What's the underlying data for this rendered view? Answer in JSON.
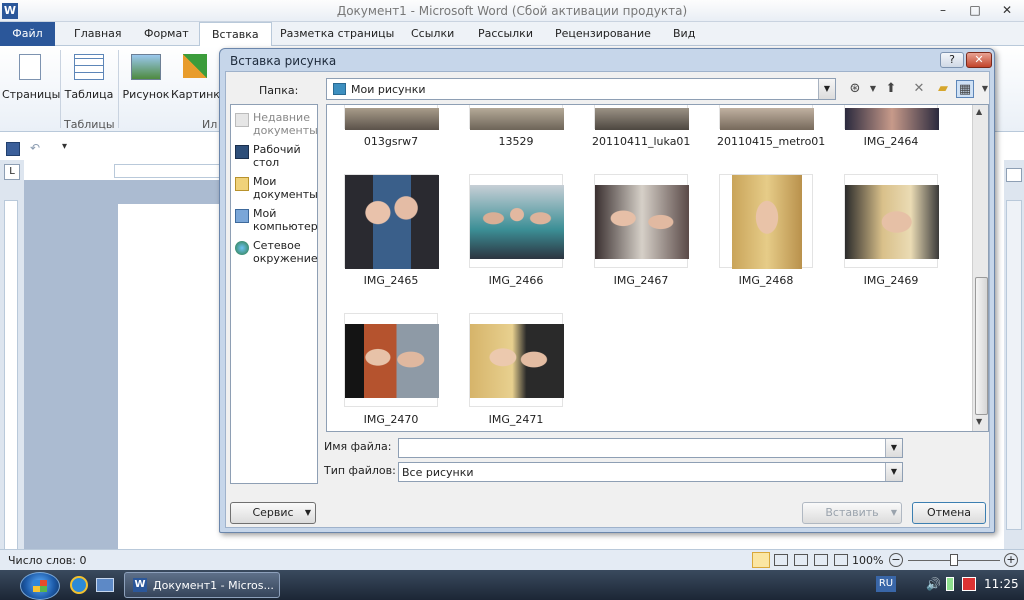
{
  "window": {
    "app_icon": "W",
    "title": "Документ1  -  Microsoft Word (Сбой активации продукта)",
    "controls": {
      "minimize": "–",
      "maximize": "□",
      "close": "✕"
    }
  },
  "ribbon": {
    "tabs": [
      "Файл",
      "Главная",
      "Формат",
      "Вставка",
      "Разметка страницы",
      "Ссылки",
      "Рассылки",
      "Рецензирование",
      "Вид"
    ],
    "buttons": {
      "pages": "Страницы",
      "table": "Таблица",
      "picture": "Рисунок",
      "clipart": "Картинки"
    },
    "groups": {
      "tables": "Таблицы",
      "illustrations_partial": "Ил"
    }
  },
  "dialog": {
    "title": "Вставка рисунка",
    "help": "?",
    "close": "✕",
    "folder_label": "Папка:",
    "folder_value": "Мои рисунки",
    "places": [
      "Недавние документы",
      "Рабочий стол",
      "Мои документы",
      "Мой компьютер",
      "Сетевое окружение"
    ],
    "files_row1": [
      "013gsrw7",
      "13529",
      "20110411_luka01",
      "20110415_metro01",
      "IMG_2464"
    ],
    "files_row2": [
      "IMG_2465",
      "IMG_2466",
      "IMG_2467",
      "IMG_2468",
      "IMG_2469"
    ],
    "files_row3": [
      "IMG_2470",
      "IMG_2471"
    ],
    "filename_label": "Имя файла:",
    "filename_value": "",
    "filetype_label": "Тип файлов:",
    "filetype_value": "Все рисунки",
    "tools_button": "Сервис",
    "insert_button": "Вставить",
    "cancel_button": "Отмена"
  },
  "statusbar": {
    "word_count": "Число слов: 0",
    "zoom": "100%"
  },
  "taskbar": {
    "task_label": "Документ1 - Micros...",
    "language": "RU",
    "clock": "11:25"
  },
  "colors": {
    "accent": "#2b579a",
    "dialog_frame": "#c6d6ea",
    "taskbar": "#1c2635"
  }
}
